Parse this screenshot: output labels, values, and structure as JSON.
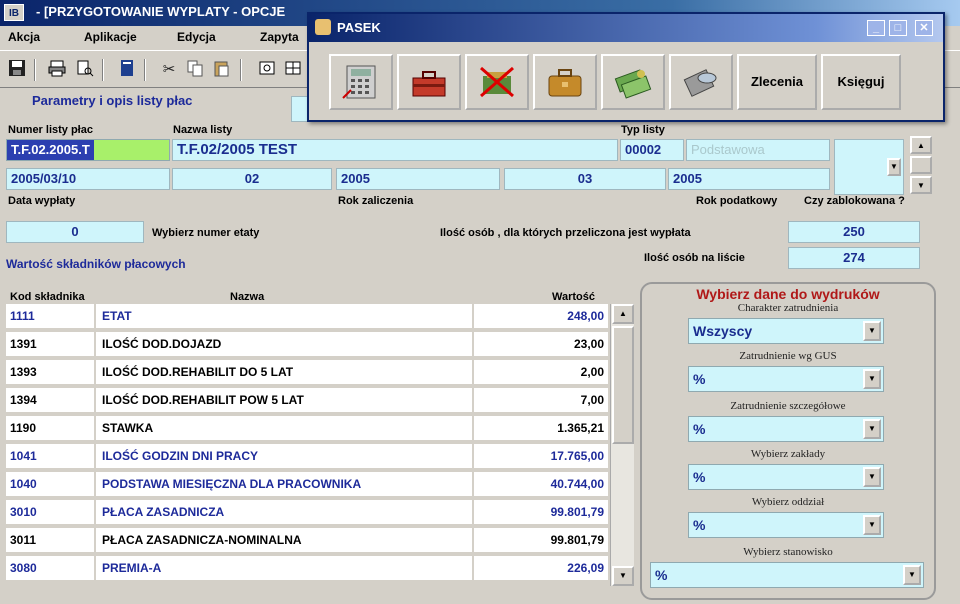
{
  "window": {
    "title": "- [PRZYGOTOWANIE WYPLATY - OPCJE",
    "icon": "app-icon"
  },
  "menu": [
    "Akcja",
    "Aplikacje",
    "Edycja",
    "Zapyta"
  ],
  "toolbar_icons": [
    "save-icon",
    "print-icon",
    "print-preview-icon",
    "book-icon",
    "cut-icon",
    "copy-icon",
    "paste-icon",
    "sum-icon",
    "grid-icon"
  ],
  "pasek": {
    "title": "PASEK",
    "buttons": [
      {
        "icon": "calculator-icon"
      },
      {
        "icon": "toolbox-icon"
      },
      {
        "icon": "cancel-tools-icon"
      },
      {
        "icon": "briefcase-icon"
      },
      {
        "icon": "money-icon"
      },
      {
        "icon": "disk-icon"
      }
    ],
    "text_buttons": [
      "Zlecenia",
      "Księguj"
    ]
  },
  "header": {
    "section_title": "Parametry i opis listy płac",
    "numer_label": "Numer listy płac",
    "numer_value": "T.F.02.2005.T",
    "nazwa_label": "Nazwa listy",
    "nazwa_value": "T.F.02/2005 TEST",
    "typ_label": "Typ listy",
    "typ_code": "00002",
    "typ_name": "Podstawowa",
    "data_wyplaty": "2005/03/10",
    "month1": "02",
    "rok_zaliczenia": "2005",
    "month2": "03",
    "rok_podatkowy": "2005",
    "data_label": "Data wypłaty",
    "rok_zal_label": "Rok zaliczenia",
    "rok_pod_label": "Rok podatkowy",
    "zablokowana_label": "Czy zablokowana ?",
    "etat_value": "0",
    "etat_label": "Wybierz numer etaty",
    "osob_przeliczona_label": "Ilość osób , dla których przeliczona jest wypłata",
    "osob_przeliczona_value": "250",
    "osob_lista_label": "Ilość osób na liście",
    "osob_lista_value": "274",
    "skladniki_title": "Wartość składników płacowych"
  },
  "table": {
    "columns": [
      "Kod składnika",
      "Nazwa",
      "Wartość"
    ],
    "rows": [
      {
        "kod": "1111",
        "nazwa": "ETAT",
        "wartosc": "248,00",
        "blue": true
      },
      {
        "kod": "1391",
        "nazwa": "ILOŚĆ DOD.DOJAZD",
        "wartosc": "23,00",
        "blue": false
      },
      {
        "kod": "1393",
        "nazwa": "ILOŚĆ DOD.REHABILIT DO 5 LAT",
        "wartosc": "2,00",
        "blue": false
      },
      {
        "kod": "1394",
        "nazwa": "ILOŚĆ DOD.REHABILIT POW 5 LAT",
        "wartosc": "7,00",
        "blue": false
      },
      {
        "kod": "1190",
        "nazwa": "STAWKA",
        "wartosc": "1.365,21",
        "blue": false
      },
      {
        "kod": "1041",
        "nazwa": "ILOŚĆ GODZIN DNI PRACY",
        "wartosc": "17.765,00",
        "blue": true
      },
      {
        "kod": "1040",
        "nazwa": "PODSTAWA MIESIĘCZNA DLA PRACOWNIKA",
        "wartosc": "40.744,00",
        "blue": true
      },
      {
        "kod": "3010",
        "nazwa": "PŁACA ZASADNICZA",
        "wartosc": "99.801,79",
        "blue": true
      },
      {
        "kod": "3011",
        "nazwa": "PŁACA ZASADNICZA-NOMINALNA",
        "wartosc": "99.801,79",
        "blue": false
      },
      {
        "kod": "3080",
        "nazwa": "PREMIA-A",
        "wartosc": "226,09",
        "blue": true
      }
    ]
  },
  "print_group": {
    "title": "Wybierz dane do wydruków",
    "fields": [
      {
        "label": "Charakter zatrudnienia",
        "value": "Wszyscy"
      },
      {
        "label": "Zatrudnienie wg GUS",
        "value": "%"
      },
      {
        "label": "Zatrudnienie szczegółowe",
        "value": "%"
      },
      {
        "label": "Wybierz zakłady",
        "value": "%"
      },
      {
        "label": "Wybierz oddział",
        "value": "%"
      },
      {
        "label": "Wybierz stanowisko",
        "value": "%"
      }
    ]
  },
  "colors": {
    "field_bg": "#cff5fb",
    "accent_blue": "#1d2a9a",
    "title_red": "#b01818"
  }
}
